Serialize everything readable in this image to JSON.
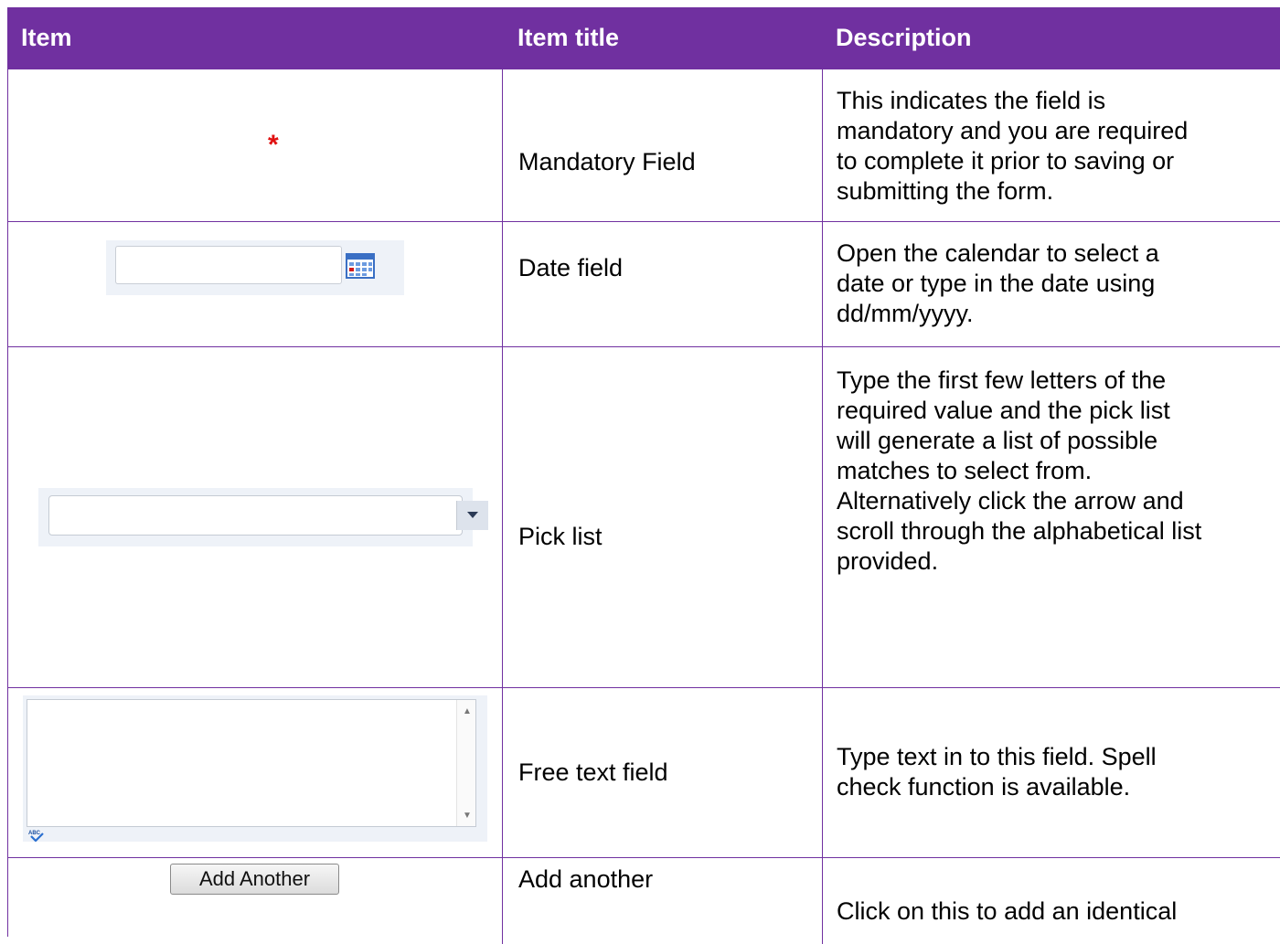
{
  "header": {
    "item": "Item",
    "title": "Item title",
    "description": "Description"
  },
  "rows": [
    {
      "item_symbol": "*",
      "title": "Mandatory Field",
      "description": [
        "This indicates the field is",
        "mandatory and you are required",
        "to complete it prior to saving or",
        "submitting the form."
      ]
    },
    {
      "title": "Date field",
      "description": [
        "Open the calendar to select a",
        "date or type in the date using",
        "dd/mm/yyyy."
      ]
    },
    {
      "title": "Pick list",
      "description": [
        "Type the first few letters of the",
        "required value and the pick list",
        "will generate a list of possible",
        "matches to select from.",
        "Alternatively click the arrow and",
        "scroll through the alphabetical list",
        "provided."
      ]
    },
    {
      "title": "Free text field",
      "spellcheck_icon_text": "ABC",
      "description": [
        "Type text in to this field. Spell",
        "check function is available."
      ]
    },
    {
      "button_label": "Add Another",
      "title": "Add another",
      "description": [
        "Click on this to add an identical"
      ]
    }
  ],
  "colors": {
    "header_bg": "#7030a0",
    "grid": "#7030a0",
    "star": "#e01010"
  }
}
